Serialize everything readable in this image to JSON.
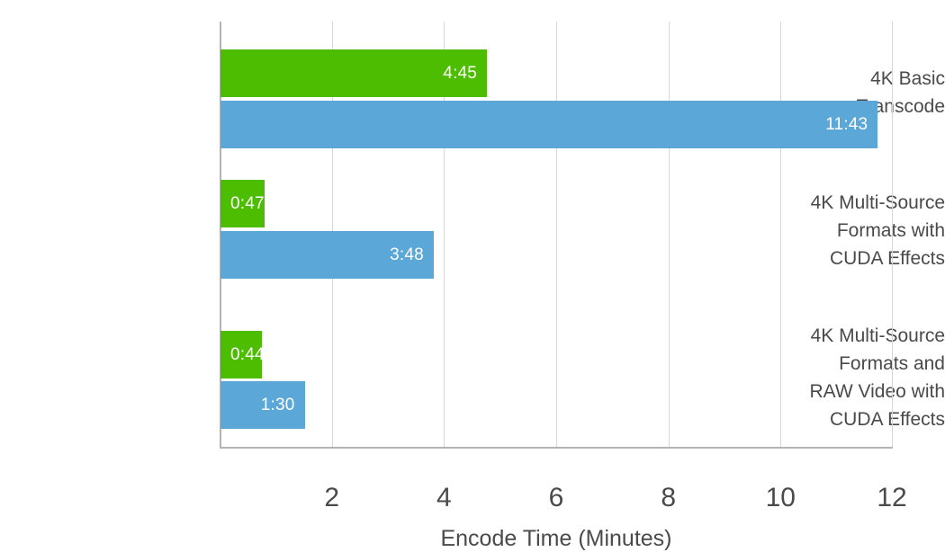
{
  "chart_data": {
    "type": "bar",
    "orientation": "horizontal",
    "title": "",
    "xlabel": "Encode Time (Minutes)",
    "ylabel": "",
    "xlim": [
      0,
      12
    ],
    "xticks": [
      2,
      4,
      6,
      8,
      10,
      12
    ],
    "xtick_labels": [
      "2",
      "4",
      "6",
      "8",
      "10",
      "12"
    ],
    "grid": true,
    "grid_axis": "x",
    "legend": false,
    "categories": [
      "4K Basic\nTranscode",
      "4K Multi-Source\nFormats with\nCUDA Effects",
      "4K Multi-Source\nFormats and\nRAW Video with\nCUDA Effects"
    ],
    "series": [
      {
        "name": "green-series",
        "color": "#4CBD00",
        "values": [
          4.75,
          0.7833,
          0.7333
        ],
        "labels": [
          "4:45",
          "0:47",
          "0:44"
        ],
        "label_position": [
          "inside-right",
          "inside-left",
          "inside-left"
        ]
      },
      {
        "name": "blue-series",
        "color": "#5BA7D8",
        "values": [
          11.7167,
          3.8,
          1.5
        ],
        "labels": [
          "11:43",
          "3:48",
          "1:30"
        ],
        "label_position": [
          "inside-right",
          "inside-right",
          "inside-right"
        ]
      }
    ],
    "colors": {
      "green": "#4CBD00",
      "blue": "#5BA7D8",
      "axis": "#b3b3b3",
      "gridline": "#d6d6d6",
      "text": "#4a4a4a",
      "value_text": "#ffffff",
      "background": "#ffffff"
    }
  },
  "category_label_tops": [
    72,
    218,
    358
  ],
  "bar_tops": [
    [
      31,
      88
    ],
    [
      176,
      233
    ],
    [
      344,
      400
    ]
  ]
}
